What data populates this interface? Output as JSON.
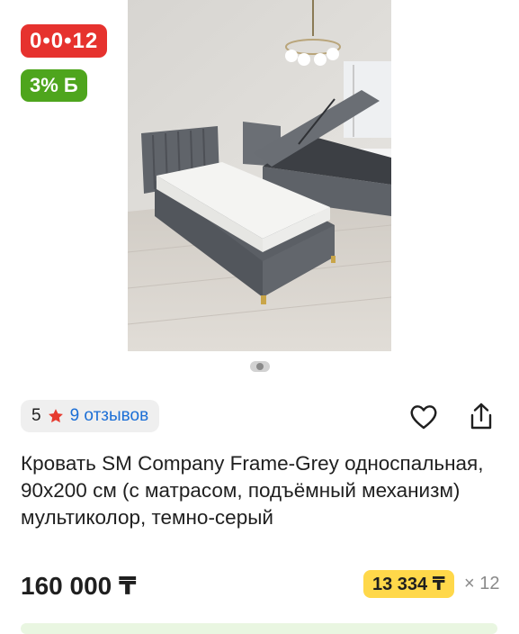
{
  "badges": {
    "installment": "0•0•12",
    "bonus": "3% Б"
  },
  "rating": {
    "score": "5",
    "reviews": "9 отзывов"
  },
  "product": {
    "title": "Кровать SM Company Frame-Grey односпальная, 90x200 см (с матрасом, подъёмный механизм) мультиколор, темно-серый",
    "price": "160 000 ₸",
    "monthly_payment": "13 334 ₸",
    "months": "× 12"
  },
  "colors": {
    "installment_badge": "#e6322e",
    "bonus_badge": "#4ea51d",
    "monthly_badge": "#ffd84a",
    "link": "#1c6fd6",
    "star": "#e63a2e"
  },
  "icons": [
    "heart-icon",
    "share-icon",
    "star-icon"
  ]
}
